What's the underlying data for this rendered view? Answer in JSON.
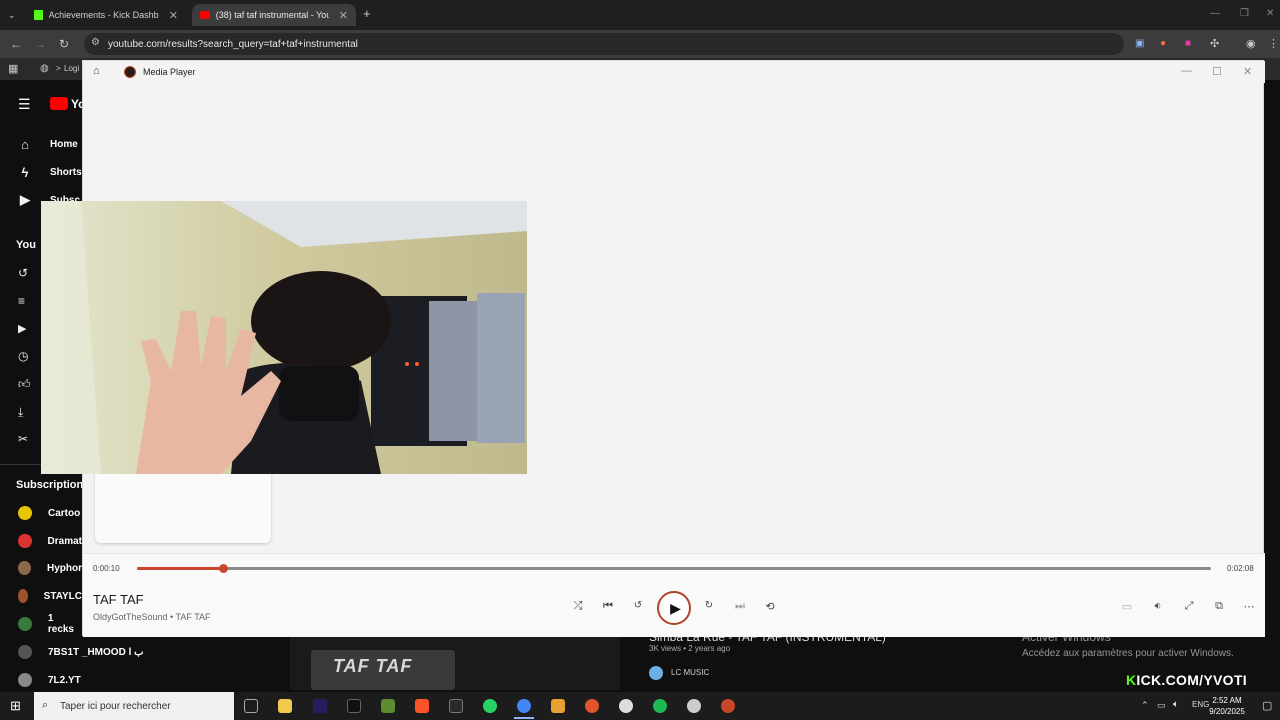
{
  "browser": {
    "tabs": [
      {
        "label": "Achievements - Kick Dashboard",
        "favicon_color": "#53fc18"
      },
      {
        "label": "(38) taf taf instrumental - YouTube",
        "favicon_color": "#ff0000"
      }
    ],
    "new_tab": "+",
    "url": "youtube.com/results?search_query=taf+taf+instrumental",
    "bookmark_label": "Logi"
  },
  "youtube": {
    "logo_text": "Yo",
    "nav": [
      {
        "label": "Home",
        "icon": "home-icon"
      },
      {
        "label": "Shorts",
        "icon": "shorts-icon"
      },
      {
        "label": "Subsc",
        "icon": "subscriptions-icon"
      }
    ],
    "you_label": "You",
    "you_items": [
      "history-icon",
      "playlists-icon",
      "your-videos-icon",
      "watch-later-icon",
      "liked-icon",
      "downloads-icon",
      "clips-icon"
    ],
    "subscriptions_label": "Subscriptions",
    "subscriptions": [
      {
        "label": "Cartoo",
        "color": "#e6c700"
      },
      {
        "label": "Dramat",
        "color": "#d33"
      },
      {
        "label": "Hyphor",
        "color": "#8a6a4a"
      },
      {
        "label": "STAYLC",
        "color": "#a0522d"
      },
      {
        "label": "1 recks",
        "color": "#3a7a3a"
      },
      {
        "label": "7BS1T _HMOOD l ب",
        "color": "#555"
      },
      {
        "label": "7L2.YT",
        "color": "#888"
      }
    ],
    "result": {
      "title": "Simba La Rue - TAF TAF (INSTRUMENTAL)",
      "meta": "3K views • 2 years ago",
      "channel": "LC MUSIC",
      "thumb_text": "TAF TAF"
    }
  },
  "media_player": {
    "app_name": "Media Player",
    "time_current": "0:00:10",
    "time_total": "0:02:08",
    "progress": 0.08,
    "song_title": "TAF TAF",
    "artist_line": "OldyGotTheSound • TAF TAF",
    "accent": "#c8462b"
  },
  "overlay": {
    "kick_k": "K",
    "kick_rest": "ICK.COM/YVOTI",
    "activate_title": "Activer Windows",
    "activate_sub": "Accédez aux paramètres pour activer Windows."
  },
  "taskbar": {
    "search_placeholder": "Taper ici pour rechercher",
    "lang": "ENG",
    "time": "2:52 AM",
    "date": "9/20/2025",
    "apps": [
      {
        "name": "task-view-icon",
        "color": "#aaa"
      },
      {
        "name": "file-explorer-icon",
        "color": "#f2c94c"
      },
      {
        "name": "premiere-icon",
        "color": "#2a1a5e"
      },
      {
        "name": "tiktok-icon",
        "color": "#111"
      },
      {
        "name": "minecraft-icon",
        "color": "#5b8c32"
      },
      {
        "name": "brave-icon",
        "color": "#fb542b"
      },
      {
        "name": "epic-games-icon",
        "color": "#2a2a2a"
      },
      {
        "name": "whatsapp-icon",
        "color": "#25d366"
      },
      {
        "name": "chrome-icon",
        "color": "#4285f4"
      },
      {
        "name": "app-orange-icon",
        "color": "#e8a030"
      },
      {
        "name": "microphone-icon",
        "color": "#e0542b"
      },
      {
        "name": "obs-icon",
        "color": "#ddd"
      },
      {
        "name": "spotify-icon",
        "color": "#1db954"
      },
      {
        "name": "steam-icon",
        "color": "#ccc"
      },
      {
        "name": "media-player-icon",
        "color": "#c8462b"
      }
    ]
  }
}
